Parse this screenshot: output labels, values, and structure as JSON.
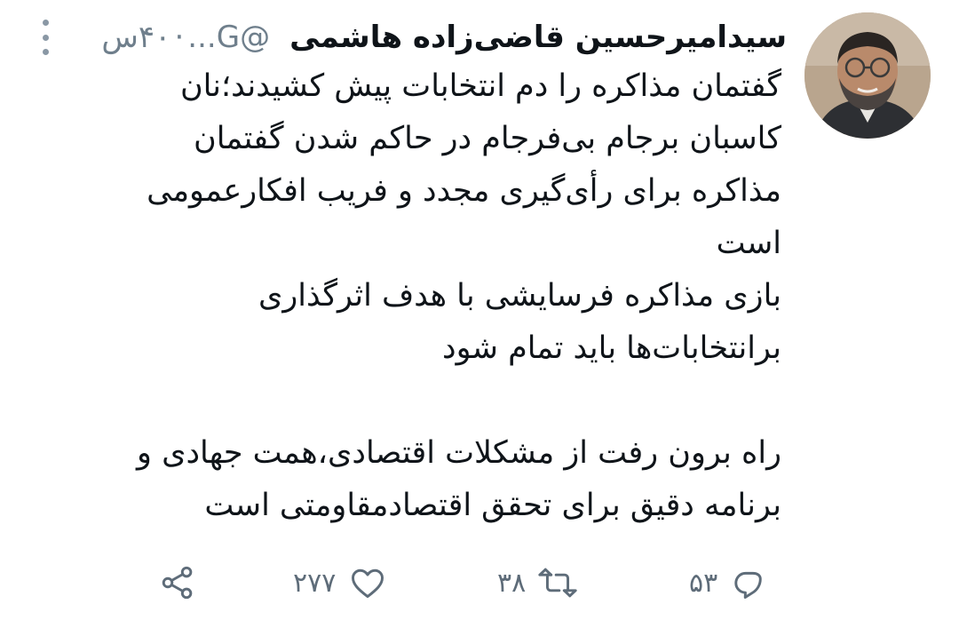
{
  "tweet": {
    "author_name": "سیدامیرحسین قاضی‌زاده هاشمی",
    "handle": "@G...",
    "separator": "·",
    "time": "۴۰س",
    "body_lines": [
      "گفتمان مذاکره را دم انتخابات پیش کشیدند؛نان",
      "کاسبان برجام بی‌فرجام در حاکم شدن گفتمان",
      "مذاکره برای رأی‌گیری مجدد و فریب افکارعمومی",
      "است",
      "بازی مذاکره فرسایشی با هدف اثرگذاری",
      "برانتخابات‌ها باید تمام شود",
      "",
      "راه برون رفت از مشکلات اقتصادی،همت جهادی و",
      "برنامه دقیق برای تحقق اقتصادمقاومتی است"
    ]
  },
  "actions": {
    "reply_count": "۵۳",
    "retweet_count": "۳۸",
    "like_count": "۲۷۷",
    "reply_icon": "reply-icon",
    "retweet_icon": "retweet-icon",
    "like_icon": "heart-icon",
    "share_icon": "share-icon"
  },
  "colors": {
    "text": "#0f1419",
    "muted": "#5e6c79",
    "background": "#ffffff"
  }
}
